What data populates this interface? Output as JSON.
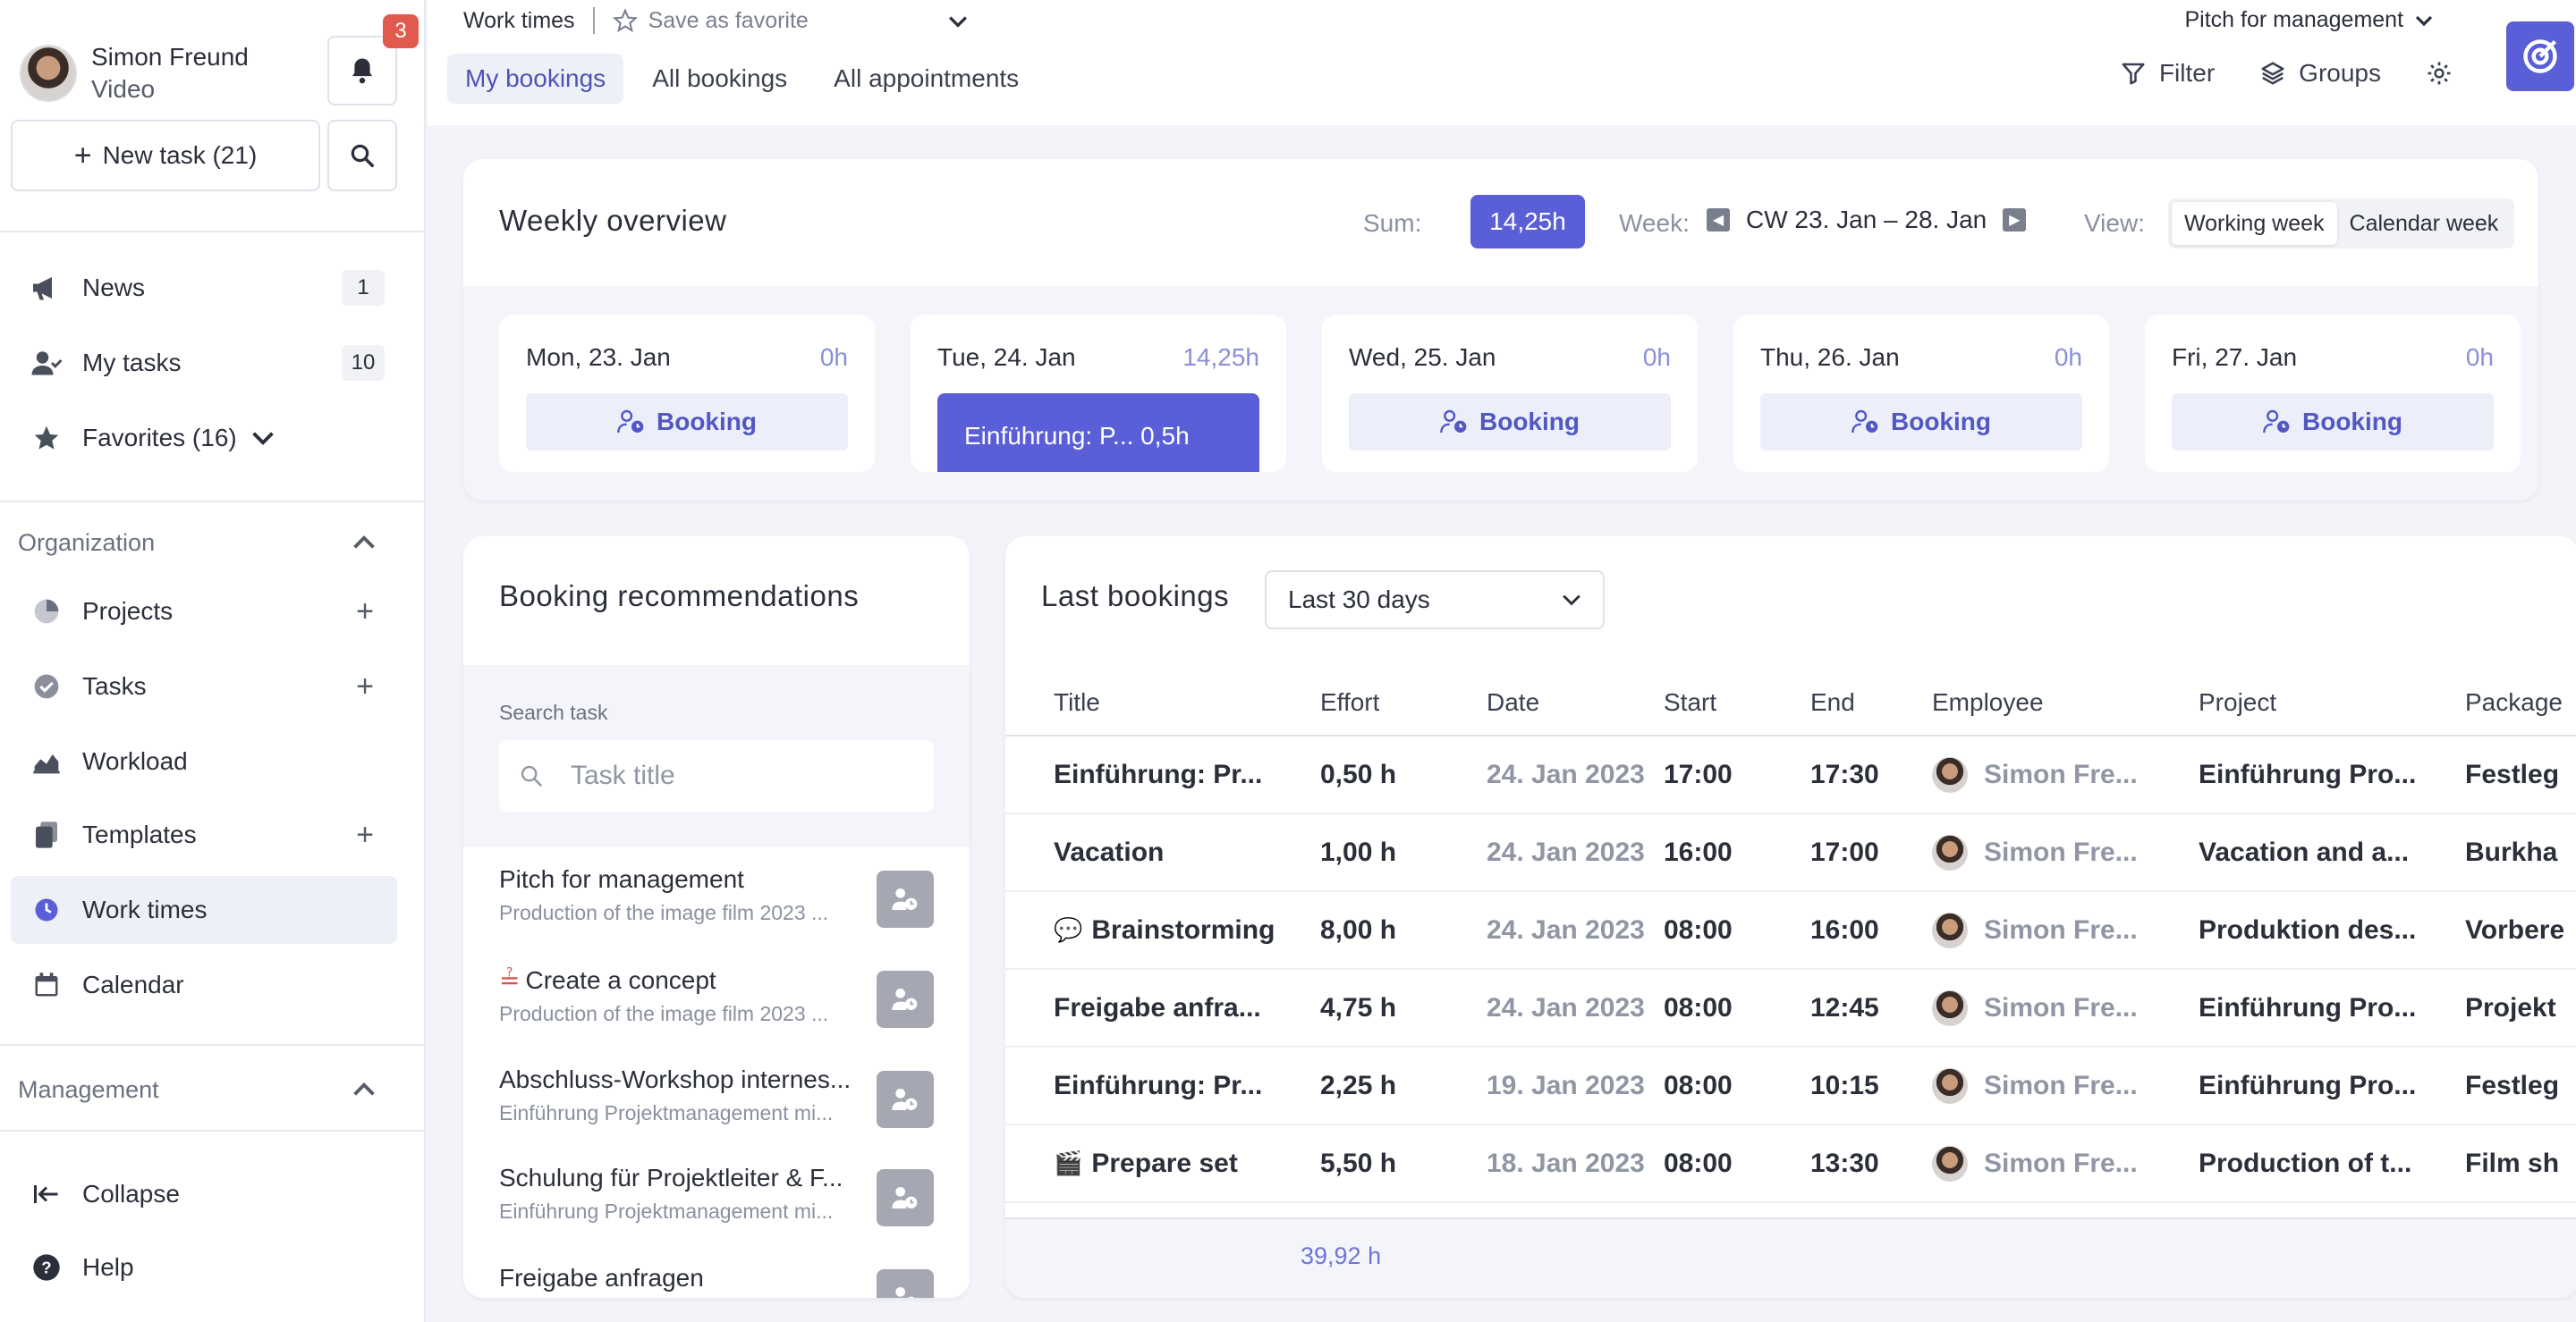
{
  "user": {
    "name": "Simon Freund",
    "role": "Video"
  },
  "notifications": {
    "count": "3"
  },
  "new_task": {
    "label": "New task (21)"
  },
  "nav": {
    "news": {
      "label": "News",
      "count": "1"
    },
    "my_tasks": {
      "label": "My tasks",
      "count": "10"
    },
    "favorites": {
      "label": "Favorites (16)"
    }
  },
  "organization": {
    "heading": "Organization",
    "items": [
      {
        "label": "Projects"
      },
      {
        "label": "Tasks"
      },
      {
        "label": "Workload"
      },
      {
        "label": "Templates"
      },
      {
        "label": "Work times"
      },
      {
        "label": "Calendar"
      }
    ]
  },
  "management": {
    "heading": "Management"
  },
  "footer_nav": {
    "collapse": "Collapse",
    "help": "Help"
  },
  "header": {
    "breadcrumb": "Work times",
    "save_favorite": "Save as favorite",
    "view_name": "Pitch for management",
    "tabs": [
      "My bookings",
      "All bookings",
      "All appointments"
    ],
    "filter": "Filter",
    "groups": "Groups"
  },
  "weekly": {
    "title": "Weekly overview",
    "sum_label": "Sum:",
    "sum_value": "14,25h",
    "week_label": "Week:",
    "week_range": "CW 23. Jan – 28. Jan",
    "view_label": "View:",
    "view_options": [
      "Working week",
      "Calendar week"
    ],
    "booking_label": "Booking",
    "days": [
      {
        "date": "Mon, 23. Jan",
        "hours": "0h"
      },
      {
        "date": "Tue, 24. Jan",
        "hours": "14,25h",
        "entry": "Einführung: P... 0,5h"
      },
      {
        "date": "Wed, 25. Jan",
        "hours": "0h"
      },
      {
        "date": "Thu, 26. Jan",
        "hours": "0h"
      },
      {
        "date": "Fri, 27. Jan",
        "hours": "0h"
      }
    ]
  },
  "recommendations": {
    "title": "Booking recommendations",
    "search_label": "Search task",
    "search_placeholder": "Task title",
    "items": [
      {
        "title": "Pitch for management",
        "sub": "Production of the image film 2023 ..."
      },
      {
        "title": "Create a concept",
        "sub": "Production of the image film 2023 ..."
      },
      {
        "title": "Abschluss-Workshop internes...",
        "sub": "Einführung Projektmanagement mi..."
      },
      {
        "title": "Schulung für Projektleiter & F...",
        "sub": "Einführung Projektmanagement mi..."
      },
      {
        "title": "Freigabe anfragen",
        "sub": ""
      }
    ]
  },
  "last_bookings": {
    "title": "Last bookings",
    "range": "Last 30 days",
    "columns": [
      "Title",
      "Effort",
      "Date",
      "Start",
      "End",
      "Employee",
      "Project",
      "Package"
    ],
    "rows": [
      {
        "emoji": "",
        "title": "Einführung: Pr...",
        "effort": "0,50 h",
        "date": "24. Jan 2023",
        "start": "17:00",
        "end": "17:30",
        "employee": "Simon Fre...",
        "project": "Einführung Pro...",
        "package": "Festleg"
      },
      {
        "emoji": "",
        "title": "Vacation",
        "effort": "1,00 h",
        "date": "24. Jan 2023",
        "start": "16:00",
        "end": "17:00",
        "employee": "Simon Fre...",
        "project": "Vacation and a...",
        "package": "Burkha"
      },
      {
        "emoji": "💬",
        "title": "Brainstorming",
        "effort": "8,00 h",
        "date": "24. Jan 2023",
        "start": "08:00",
        "end": "16:00",
        "employee": "Simon Fre...",
        "project": "Produktion des...",
        "package": "Vorbere"
      },
      {
        "emoji": "",
        "title": "Freigabe anfra...",
        "effort": "4,75 h",
        "date": "24. Jan 2023",
        "start": "08:00",
        "end": "12:45",
        "employee": "Simon Fre...",
        "project": "Einführung Pro...",
        "package": "Projekt"
      },
      {
        "emoji": "",
        "title": "Einführung: Pr...",
        "effort": "2,25 h",
        "date": "19. Jan 2023",
        "start": "08:00",
        "end": "10:15",
        "employee": "Simon Fre...",
        "project": "Einführung Pro...",
        "package": "Festleg"
      },
      {
        "emoji": "🎬",
        "title": "Prepare set",
        "effort": "5,50 h",
        "date": "18. Jan 2023",
        "start": "08:00",
        "end": "13:30",
        "employee": "Simon Fre...",
        "project": "Production of t...",
        "package": "Film sh"
      }
    ],
    "total_effort": "39,92 h"
  },
  "colors": {
    "accent": "#5a5fd8",
    "badge": "#e25a4d",
    "page_bg": "#f3f4f9"
  }
}
